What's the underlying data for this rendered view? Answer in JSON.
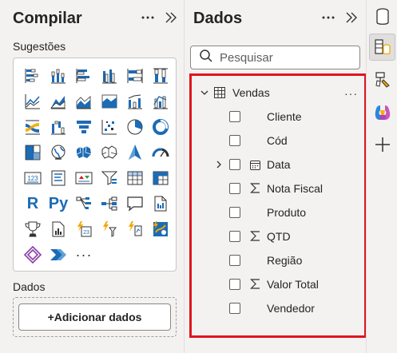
{
  "compile_pane": {
    "title": "Compilar",
    "more_icon": "ellipsis-icon",
    "collapse_icon": "double-chevron-right-icon",
    "suggestions_label": "Sugestões",
    "viz_icons": [
      "stacked-bar-chart-icon",
      "stacked-column-chart-icon",
      "clustered-bar-chart-icon",
      "clustered-column-chart-icon",
      "100-stacked-bar-chart-icon",
      "100-stacked-column-chart-icon",
      "line-chart-icon",
      "area-chart-icon",
      "stacked-area-chart-icon",
      "100-stacked-area-chart-icon",
      "line-clustered-column-chart-icon",
      "line-stacked-column-chart-icon",
      "ribbon-chart-icon",
      "waterfall-chart-icon",
      "funnel-chart-icon",
      "scatter-chart-icon",
      "pie-chart-icon",
      "donut-chart-icon",
      "treemap-icon",
      "map-icon",
      "filled-map-icon",
      "shape-map-icon",
      "azure-map-icon",
      "gauge-icon",
      "card-icon",
      "multi-row-card-icon",
      "kpi-icon",
      "slicer-icon",
      "table-icon",
      "matrix-icon",
      "r-visual-icon",
      "python-visual-icon",
      "key-influencers-icon",
      "decomposition-tree-icon",
      "qa-icon",
      "paginated-report-icon",
      "trophy-icon",
      "narrative-icon",
      "power-apps-icon",
      "power-automate-icon",
      "metrics-icon",
      "arcgis-icon",
      "diamond-icon",
      "power-automate-arrow-icon",
      "more-visuals-icon"
    ],
    "r_text": "R",
    "py_text": "Py",
    "more_visuals_text": "···",
    "data_label": "Dados",
    "add_data_button": "+Adicionar dados"
  },
  "data_pane": {
    "title": "Dados",
    "more_icon": "ellipsis-icon",
    "collapse_icon": "double-chevron-right-icon",
    "search_placeholder": "Pesquisar",
    "table": {
      "name": "Vendas",
      "more": "···",
      "fields": [
        {
          "label": "Cliente",
          "icon": "",
          "expandable": false
        },
        {
          "label": "Cód",
          "icon": "",
          "expandable": false
        },
        {
          "label": "Data",
          "icon": "calendar-icon",
          "expandable": true
        },
        {
          "label": "Nota Fiscal",
          "icon": "sigma-icon",
          "expandable": false
        },
        {
          "label": "Produto",
          "icon": "",
          "expandable": false
        },
        {
          "label": "QTD",
          "icon": "sigma-icon",
          "expandable": false
        },
        {
          "label": "Região",
          "icon": "",
          "expandable": false
        },
        {
          "label": "Valor Total",
          "icon": "sigma-icon",
          "expandable": false
        },
        {
          "label": "Vendedor",
          "icon": "",
          "expandable": false
        }
      ]
    }
  },
  "rail": {
    "items": [
      "cylinder-icon",
      "data-pane-icon",
      "format-brush-icon",
      "copilot-icon",
      "add-icon"
    ]
  },
  "colors": {
    "highlight_border": "#e0141e",
    "viz_blue": "#1c6bb5",
    "viz_orange": "#f2a900"
  }
}
